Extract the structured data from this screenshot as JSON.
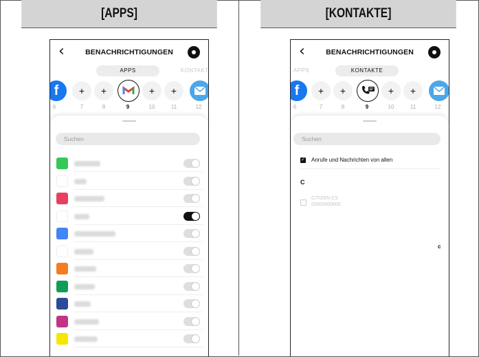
{
  "headers": {
    "left": "[APPS]",
    "right": "[KONTAKTE]"
  },
  "screen_title": "BENACHRICHTIGUNGEN",
  "tabs": {
    "apps": "APPS",
    "contacts": "KONTAKTE"
  },
  "slot_numbers": [
    "6",
    "7",
    "8",
    "9",
    "10",
    "11",
    "12"
  ],
  "selected_slot": "9",
  "plus": "+",
  "back_glyph": "‹",
  "search_placeholder": "Suchen",
  "apps": [
    {
      "icon": "facetime-icon",
      "color": "#35c759",
      "enabled": false
    },
    {
      "icon": "flickr-icon",
      "color": "#ffffff",
      "enabled": false
    },
    {
      "icon": "pink-app-icon",
      "color": "#e9405f",
      "enabled": false
    },
    {
      "icon": "gmail-icon",
      "color": "#ffffff",
      "enabled": true
    },
    {
      "icon": "calendar-icon",
      "color": "#4285f4",
      "enabled": false
    },
    {
      "icon": "meta-icon",
      "color": "#ffffff",
      "enabled": false
    },
    {
      "icon": "orange-app-icon",
      "color": "#f57c1f",
      "enabled": false
    },
    {
      "icon": "hangouts-icon",
      "color": "#0f9d58",
      "enabled": false
    },
    {
      "icon": "messenger-icon",
      "color": "#2c4a9a",
      "enabled": false
    },
    {
      "icon": "instagram-icon",
      "color": "#c13584",
      "enabled": false
    },
    {
      "icon": "kakaotalk-icon",
      "color": "#f7e600",
      "enabled": false
    }
  ],
  "contacts": {
    "allow_all_label": "Anrufe und Nachrichten von allen",
    "section": "C",
    "entries": [
      {
        "name": "CITIZEN CS",
        "number": "00000000000"
      }
    ]
  },
  "side_letter": "c"
}
